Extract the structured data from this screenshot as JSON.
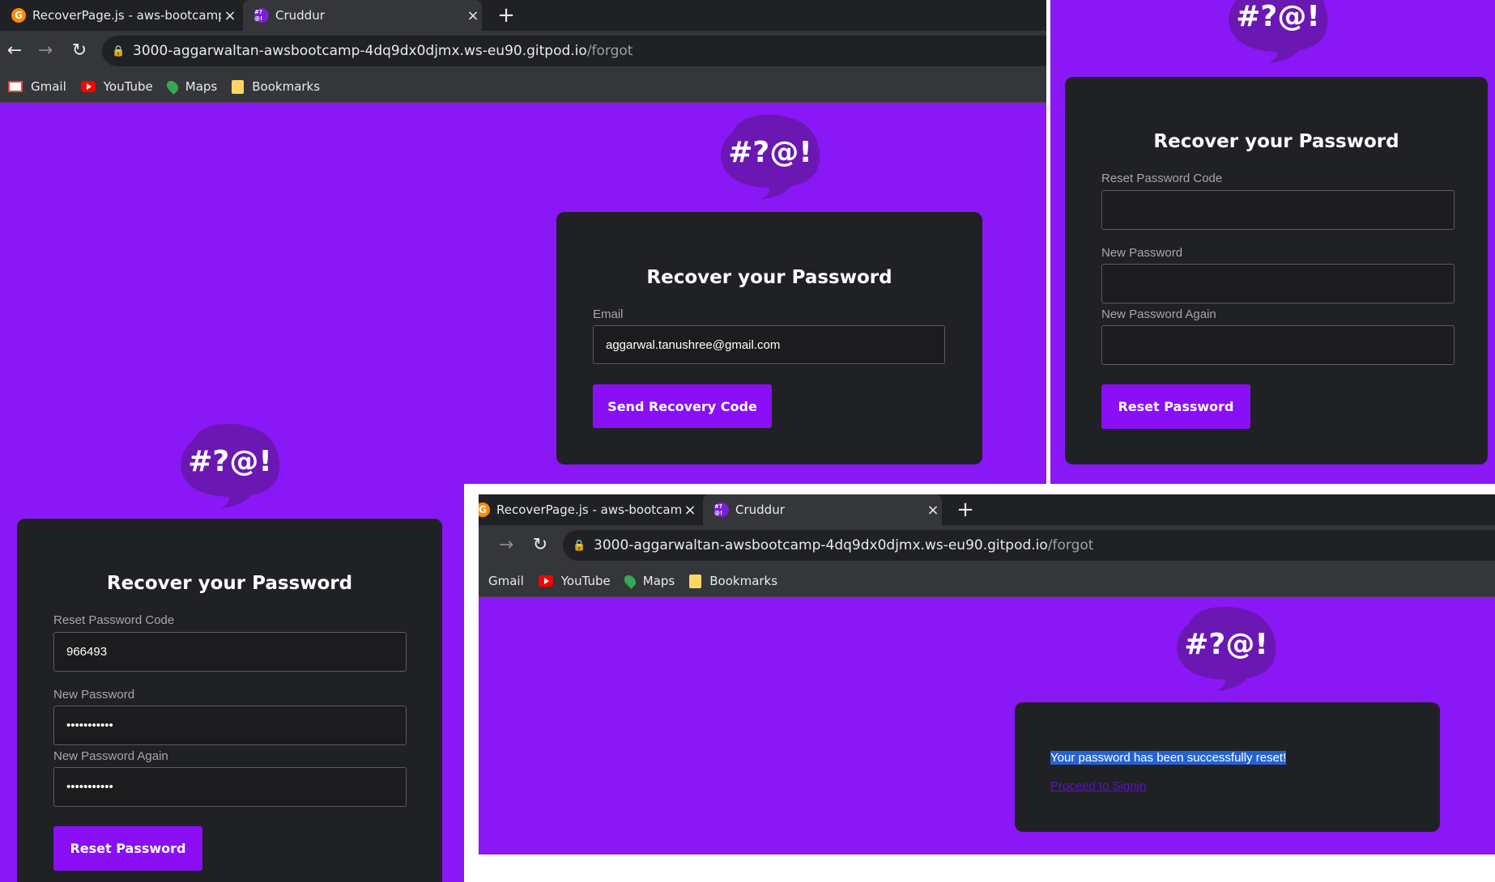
{
  "browser": {
    "tabs": [
      {
        "title": "RecoverPage.js - aws-bootcamp-",
        "favicon": "gitpod-icon",
        "close": "×"
      },
      {
        "title": "Cruddur",
        "favicon": "cruddur-icon",
        "close": "×"
      }
    ],
    "new_tab": "+",
    "nav": {
      "back": "←",
      "forward": "→",
      "reload": "↻"
    },
    "url_host": "3000-aggarwaltan-awsbootcamp-4dq9dx0djmx.ws-eu90.gitpod.io",
    "url_path": "/forgot",
    "bookmarks": [
      "Gmail",
      "YouTube",
      "Maps",
      "Bookmarks"
    ]
  },
  "logo_text": "#?@!",
  "panel_email": {
    "title": "Recover your Password",
    "email_label": "Email",
    "email_value": "aggarwal.tanushree@gmail.com",
    "button": "Send Recovery Code"
  },
  "panel_reset_empty": {
    "title": "Recover your Password",
    "code_label": "Reset Password Code",
    "code_value": "",
    "new_label": "New Password",
    "new_value": "",
    "again_label": "New Password Again",
    "again_value": "",
    "button": "Reset Password"
  },
  "panel_reset_filled": {
    "title": "Recover your Password",
    "code_label": "Reset Password Code",
    "code_value": "966493",
    "new_label": "New Password",
    "new_value": "•••••••••••",
    "again_label": "New Password Again",
    "again_value": "•••••••••••",
    "button": "Reset Password"
  },
  "panel_success": {
    "message": "Your password has been successfully reset!",
    "link": "Proceed to Signin"
  },
  "colors": {
    "page_bg": "#8a17f5",
    "card_bg": "#202124",
    "button_bg": "#8a0ff5",
    "logo_bubble": "#6b17b3"
  }
}
